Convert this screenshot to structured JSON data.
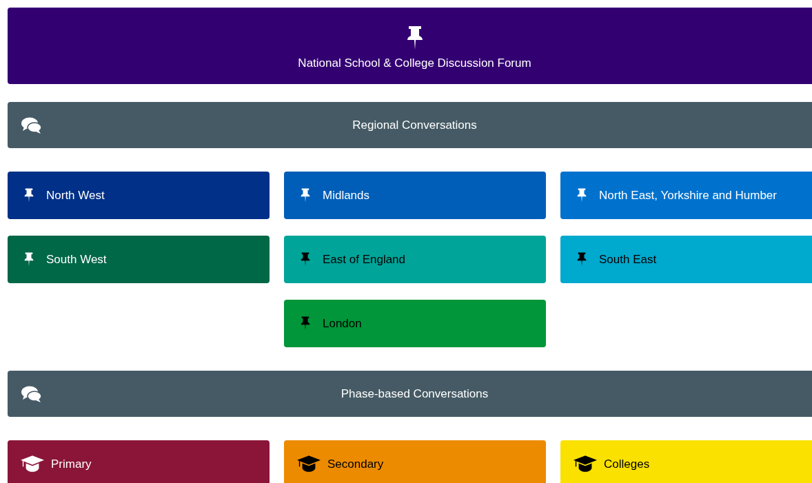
{
  "banner": {
    "title": "National School & College Discussion Forum"
  },
  "sections": [
    {
      "title": "Regional Conversations",
      "tiles": [
        {
          "label": "North West",
          "color": "#003087",
          "dark_text": false
        },
        {
          "label": "Midlands",
          "color": "#005eb8",
          "dark_text": false
        },
        {
          "label": "North East, Yorkshire and Humber",
          "color": "#0072ce",
          "dark_text": false
        },
        {
          "label": "South West",
          "color": "#006747",
          "dark_text": false
        },
        {
          "label": "East of England",
          "color": "#00a499",
          "dark_text": true
        },
        {
          "label": "South East",
          "color": "#00a9ce",
          "dark_text": true
        },
        {
          "label": "London",
          "color": "#009639",
          "dark_text": true
        }
      ]
    },
    {
      "title": "Phase-based Conversations",
      "tiles": [
        {
          "label": "Primary",
          "color": "#8a1538",
          "dark_text": false
        },
        {
          "label": "Secondary",
          "color": "#ed8b00",
          "dark_text": true
        },
        {
          "label": "Colleges",
          "color": "#fae100",
          "dark_text": true
        }
      ]
    }
  ]
}
